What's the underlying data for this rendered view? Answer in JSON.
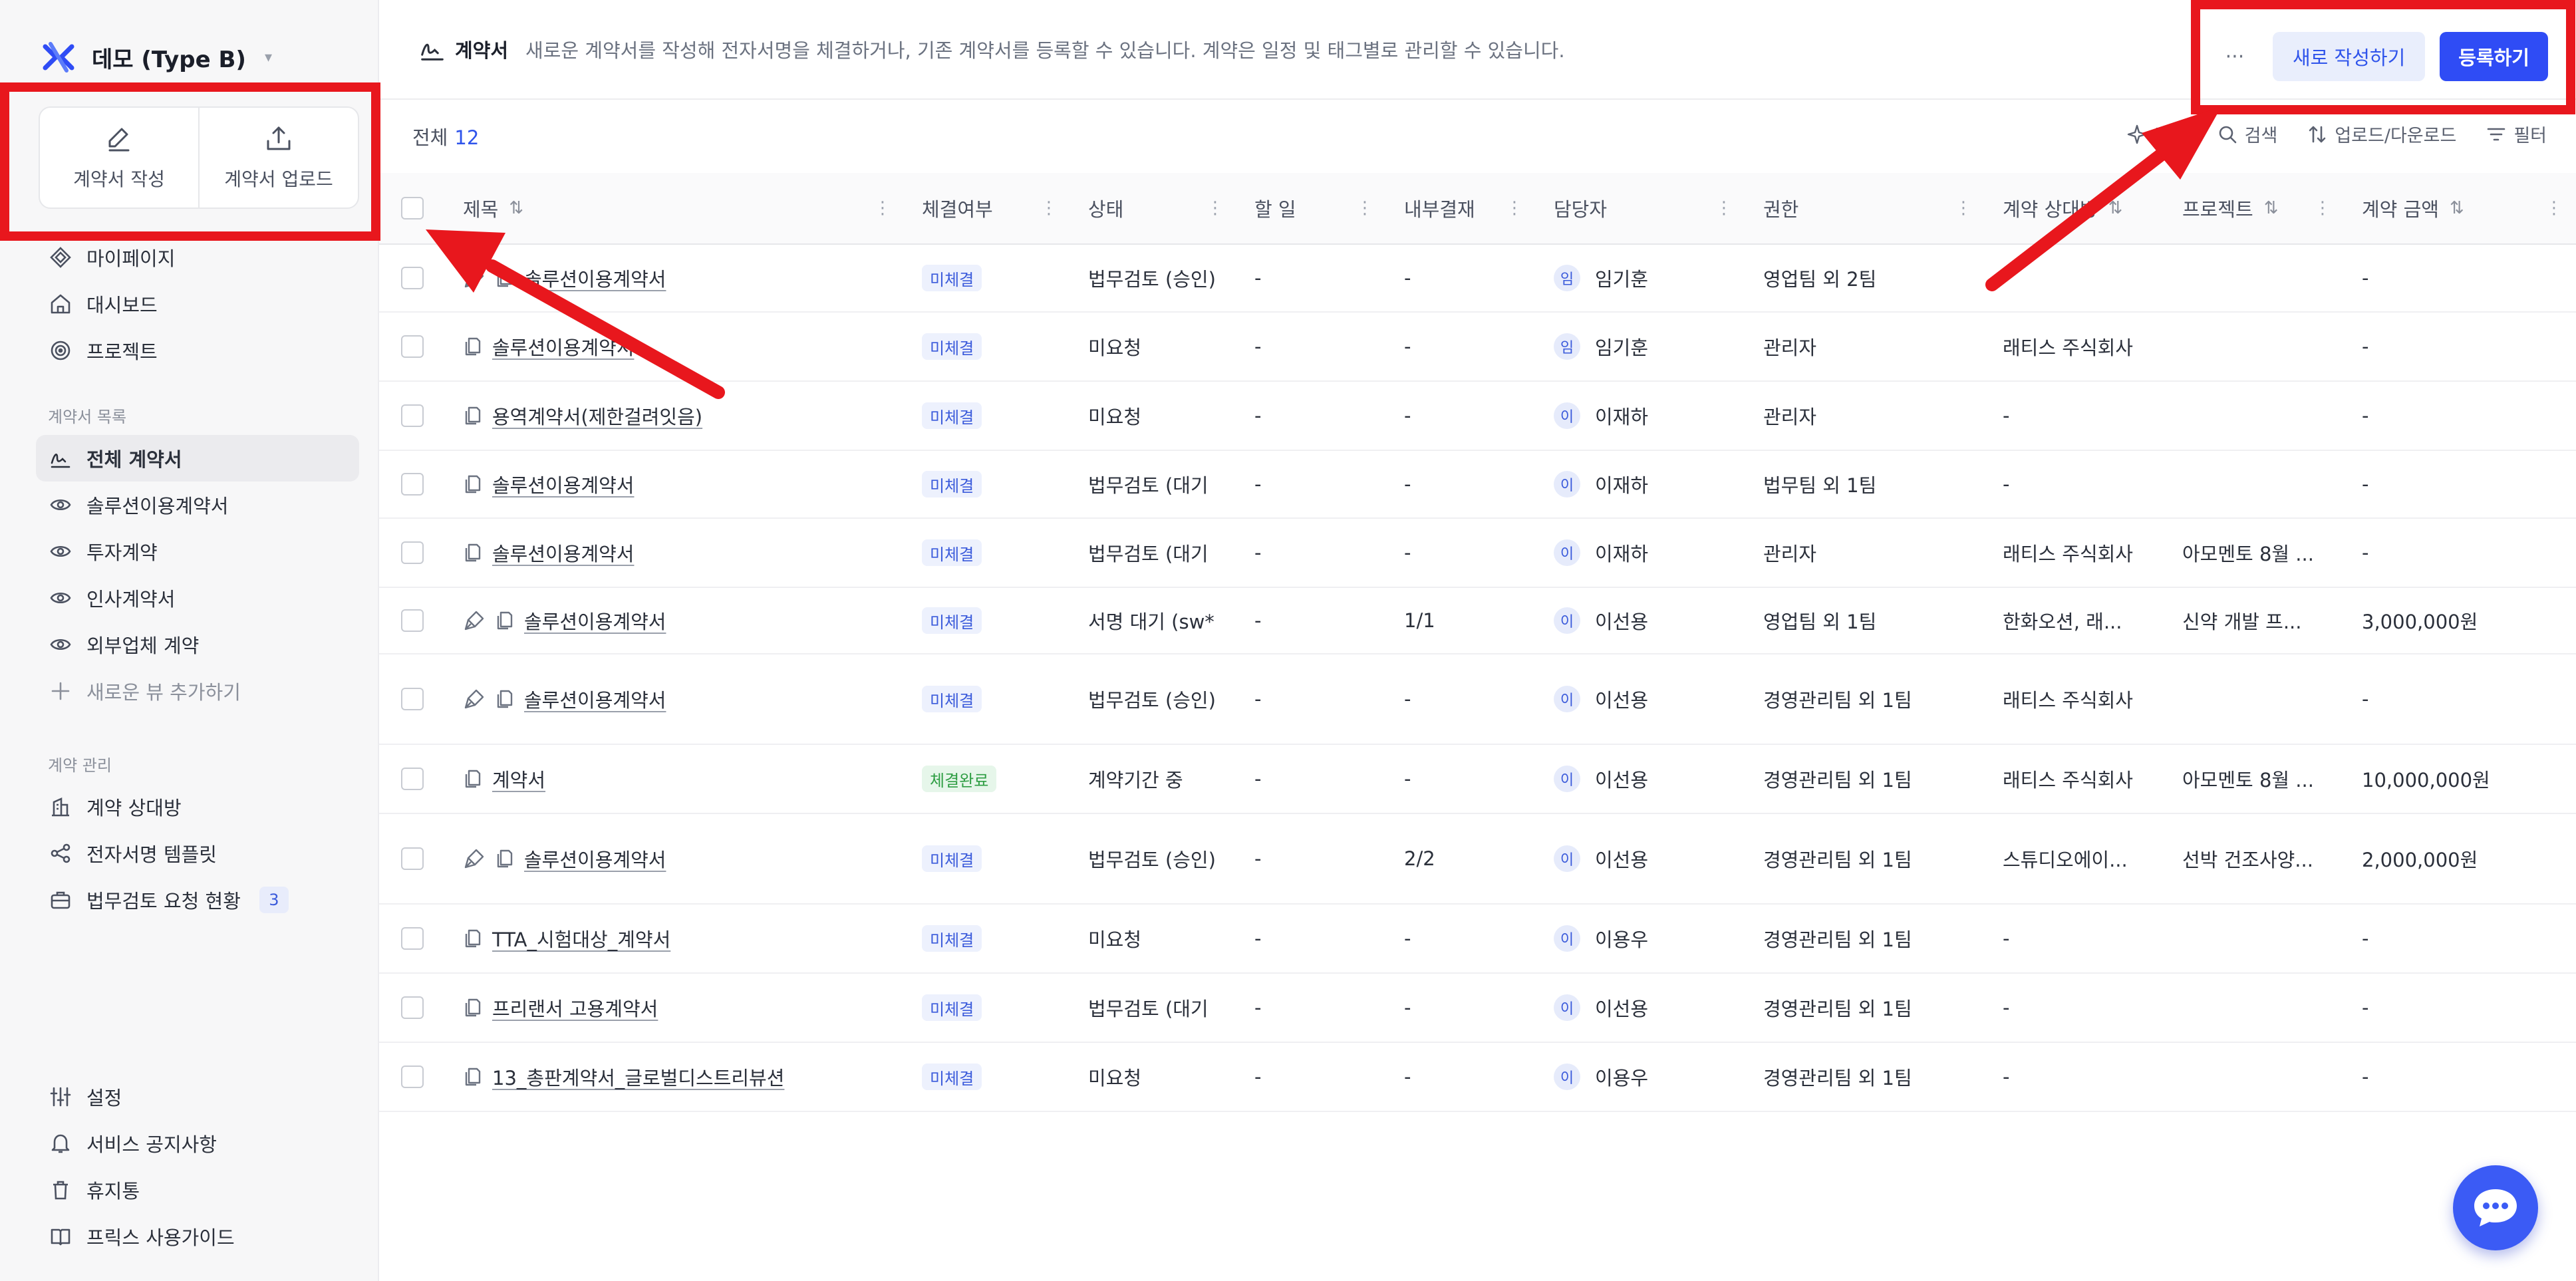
{
  "workspace": {
    "name": "데모 (Type B)"
  },
  "quick_actions": {
    "write": "계약서 작성",
    "upload": "계약서 업로드"
  },
  "nav_top": [
    {
      "label": "마이페이지",
      "icon": "diamond-icon"
    },
    {
      "label": "대시보드",
      "icon": "home-icon"
    },
    {
      "label": "프로젝트",
      "icon": "target-icon"
    }
  ],
  "nav_contracts": {
    "section": "계약서 목록",
    "items": [
      {
        "label": "전체 계약서",
        "icon": "signature-icon",
        "active": true
      },
      {
        "label": "솔루션이용계약서",
        "icon": "eye-icon"
      },
      {
        "label": "투자계약",
        "icon": "eye-icon"
      },
      {
        "label": "인사계약서",
        "icon": "eye-icon"
      },
      {
        "label": "외부업체 계약",
        "icon": "eye-icon"
      },
      {
        "label": "새로운 뷰 추가하기",
        "icon": "plus-icon"
      }
    ]
  },
  "nav_manage": {
    "section": "계약 관리",
    "items": [
      {
        "label": "계약 상대방",
        "icon": "building-icon"
      },
      {
        "label": "전자서명 템플릿",
        "icon": "share-icon"
      },
      {
        "label": "법무검토 요청 현황",
        "icon": "briefcase-icon",
        "badge": "3"
      }
    ]
  },
  "nav_bottom": [
    {
      "label": "설정",
      "icon": "sliders-icon"
    },
    {
      "label": "서비스 공지사항",
      "icon": "bell-icon"
    },
    {
      "label": "휴지통",
      "icon": "trash-icon"
    },
    {
      "label": "프릭스 사용가이드",
      "icon": "book-icon"
    }
  ],
  "header": {
    "title": "계약서",
    "description": "새로운 계약서를 작성해 전자서명을 체결하거나, 기존 계약서를 등록할 수 있습니다. 계약은 일정 및 태그별로 관리할 수 있습니다.",
    "more": "···",
    "new_button": "새로 작성하기",
    "register_button": "등록하기"
  },
  "toolbar": {
    "total_label": "전체",
    "total_count": "12",
    "ai_search": "검색",
    "search": "검색",
    "updown": "업로드/다운로드",
    "filter": "필터"
  },
  "columns": {
    "title": "제목",
    "sign": "체결여부",
    "status": "상태",
    "todo": "할 일",
    "approval": "내부결재",
    "owner": "담당자",
    "perm": "권한",
    "party": "계약 상대방",
    "proj": "프로젝트",
    "amount": "계약 금액"
  },
  "rows": [
    {
      "title": "솔루션이용계약서",
      "esign": true,
      "sign": "미체결",
      "signed": false,
      "status": "법무검토 (승인)",
      "todo": "-",
      "approval": "-",
      "avatar": "임",
      "owner": "임기훈",
      "perm": "영업팀 외 2팀",
      "party": "",
      "proj": "",
      "amount": "-"
    },
    {
      "title": "솔루션이용계약서",
      "esign": false,
      "sign": "미체결",
      "signed": false,
      "status": "미요청",
      "todo": "-",
      "approval": "-",
      "avatar": "임",
      "owner": "임기훈",
      "perm": "관리자",
      "party": "래티스 주식회사",
      "proj": "",
      "amount": "-"
    },
    {
      "title": "용역계약서(제한걸려잇음)",
      "esign": false,
      "sign": "미체결",
      "signed": false,
      "status": "미요청",
      "todo": "-",
      "approval": "-",
      "avatar": "이",
      "owner": "이재하",
      "perm": "관리자",
      "party": "-",
      "proj": "",
      "amount": "-"
    },
    {
      "title": "솔루션이용계약서",
      "esign": false,
      "sign": "미체결",
      "signed": false,
      "status": "법무검토 (대기",
      "todo": "-",
      "approval": "-",
      "avatar": "이",
      "owner": "이재하",
      "perm": "법무팀 외 1팀",
      "party": "-",
      "proj": "",
      "amount": "-"
    },
    {
      "title": "솔루션이용계약서",
      "esign": false,
      "sign": "미체결",
      "signed": false,
      "status": "법무검토 (대기",
      "todo": "-",
      "approval": "-",
      "avatar": "이",
      "owner": "이재하",
      "perm": "관리자",
      "party": "래티스 주식회사",
      "proj": "아모멘토 8월 ...",
      "amount": "-"
    },
    {
      "title": "솔루션이용계약서",
      "esign": true,
      "sign": "미체결",
      "signed": false,
      "status": "서명 대기 (sw*",
      "todo": "-",
      "approval": "1/1",
      "avatar": "이",
      "owner": "이선용",
      "perm": "영업팀 외 1팀",
      "party": "한화오션, 래...",
      "proj": "신약 개발 프...",
      "amount": "3,000,000원"
    },
    {
      "title": "솔루션이용계약서",
      "esign": true,
      "sign": "미체결",
      "signed": false,
      "status": "법무검토 (승인)",
      "todo": "-",
      "approval": "-",
      "avatar": "이",
      "owner": "이선용",
      "perm": "경영관리팀 외 1팀",
      "party": "래티스 주식회사",
      "proj": "",
      "amount": "-"
    },
    {
      "title": "계약서",
      "esign": false,
      "sign": "체결완료",
      "signed": true,
      "status": "계약기간 중",
      "todo": "-",
      "approval": "-",
      "avatar": "이",
      "owner": "이선용",
      "perm": "경영관리팀 외 1팀",
      "party": "래티스 주식회사",
      "proj": "아모멘토 8월 ...",
      "amount": "10,000,000원"
    },
    {
      "title": "솔루션이용계약서",
      "esign": true,
      "sign": "미체결",
      "signed": false,
      "status": "법무검토 (승인)",
      "todo": "-",
      "approval": "2/2",
      "avatar": "이",
      "owner": "이선용",
      "perm": "경영관리팀 외 1팀",
      "party": "스튜디오에이...",
      "proj": "선박 건조사양...",
      "amount": "2,000,000원"
    },
    {
      "title": "TTA_시험대상_계약서",
      "esign": false,
      "sign": "미체결",
      "signed": false,
      "status": "미요청",
      "todo": "-",
      "approval": "-",
      "avatar": "이",
      "owner": "이용우",
      "perm": "경영관리팀 외 1팀",
      "party": "-",
      "proj": "",
      "amount": "-"
    },
    {
      "title": "프리랜서 고용계약서",
      "esign": false,
      "sign": "미체결",
      "signed": false,
      "status": "법무검토 (대기",
      "todo": "-",
      "approval": "-",
      "avatar": "이",
      "owner": "이선용",
      "perm": "경영관리팀 외 1팀",
      "party": "-",
      "proj": "",
      "amount": "-"
    },
    {
      "title": "13_총판계약서_글로벌디스트리뷰션",
      "esign": false,
      "sign": "미체결",
      "signed": false,
      "status": "미요청",
      "todo": "-",
      "approval": "-",
      "avatar": "이",
      "owner": "이용우",
      "perm": "경영관리팀 외 1팀",
      "party": "-",
      "proj": "",
      "amount": "-"
    }
  ],
  "colors": {
    "primary": "#2f4cf5",
    "annotation_red": "#e8171d",
    "pending_pill": "#edf1fd",
    "done_pill": "#e6f6ea"
  }
}
